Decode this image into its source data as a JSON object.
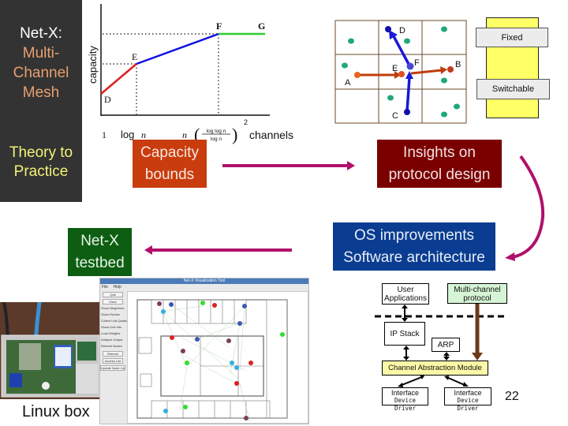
{
  "sidebar": {
    "title_line1": "Net-X:",
    "title_rest": [
      "Multi-",
      "Channel",
      "Mesh"
    ],
    "theory_line1": "Theory to",
    "theory_line2": "Practice"
  },
  "colors": {
    "sidebar_bg": "#333333",
    "capacity_box": "#c93c0e",
    "insights_box": "#7a0000",
    "os_box": "#0a3d91",
    "testbed_box": "#0d5e12",
    "flow_arrow": "#b0106a"
  },
  "capacity_chart": {
    "ylabel": "capacity",
    "xlabel_suffix": "channels",
    "x_ticks": [
      "1",
      "log n",
      "n (log log n / log n)^2"
    ],
    "points": [
      {
        "label": "D",
        "segment_color": "#dd2020"
      },
      {
        "label": "E",
        "segment_color": "#1010dd"
      },
      {
        "label": "F",
        "segment_color": "#30cc30"
      },
      {
        "label": "G"
      }
    ],
    "tick_1": "1",
    "tick_log": "log",
    "tick_n": "n",
    "frac_num": "log log n",
    "frac_den": "log n",
    "exponent": "2"
  },
  "flow": {
    "capacity_line1": "Capacity",
    "capacity_line2": "bounds",
    "insights_line1": "Insights on",
    "insights_line2": "protocol design",
    "os_line1": "OS improvements",
    "os_line2": "Software architecture",
    "testbed_line1": "Net-X",
    "testbed_line2": "testbed"
  },
  "grid_diagram": {
    "node_labels": [
      "A",
      "B",
      "C",
      "D",
      "E",
      "F"
    ],
    "interface_labels": {
      "fixed": "Fixed",
      "switchable": "Switchable"
    }
  },
  "linux_box": {
    "caption": "Linux box"
  },
  "viz_tool": {
    "title": "Net-X Visualization Tool",
    "menu": [
      "File",
      "Help"
    ],
    "buttons": [
      "Quit",
      "Clear"
    ],
    "checkboxes": [
      "Show Neighbors",
      "Show Routes",
      "Collect Link Quality",
      "Show Link Info",
      "Load Weights",
      "Analyze Output",
      "Refresh Nodes"
    ],
    "action_buttons": [
      "Refresh",
      "Access List",
      "Update Node List"
    ]
  },
  "architecture": {
    "user_apps_line1": "User",
    "user_apps_line2": "Applications",
    "multichannel_line1": "Multi-channel",
    "multichannel_line2": "protocol",
    "ip_stack": "IP Stack",
    "arp": "ARP",
    "cam": "Channel Abstraction Module",
    "interface": "Interface",
    "device_driver": "Device Driver"
  },
  "page_number": "22"
}
